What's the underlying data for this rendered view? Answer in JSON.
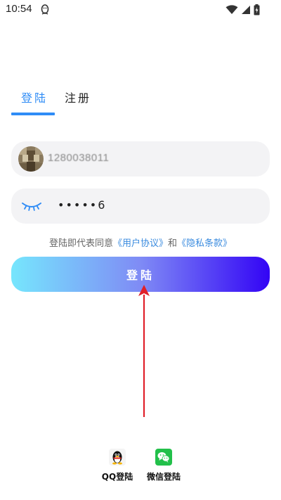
{
  "status_bar": {
    "time": "10:54"
  },
  "tabs": [
    {
      "label": "登陆",
      "active": true
    },
    {
      "label": "注册",
      "active": false
    }
  ],
  "form": {
    "phone_value": "1280038011",
    "password_value": "•••••6"
  },
  "agreement": {
    "prefix": "登陆即代表同意",
    "user_agreement": "《用户协议》",
    "conjunction": "和",
    "privacy_policy": "《隐私条款》"
  },
  "login_button": {
    "label": "登陆"
  },
  "social": [
    {
      "label": "QQ登陆",
      "icon": "qq-penguin-icon"
    },
    {
      "label": "微信登陆",
      "icon": "wechat-icon"
    }
  ],
  "colors": {
    "accent": "#2f8cf6",
    "link": "#3a8bdf",
    "button_gradient_start": "#76e6fd",
    "button_gradient_end": "#3304f5",
    "annotation_arrow": "#e0202a",
    "wechat_green": "#22c04a"
  }
}
